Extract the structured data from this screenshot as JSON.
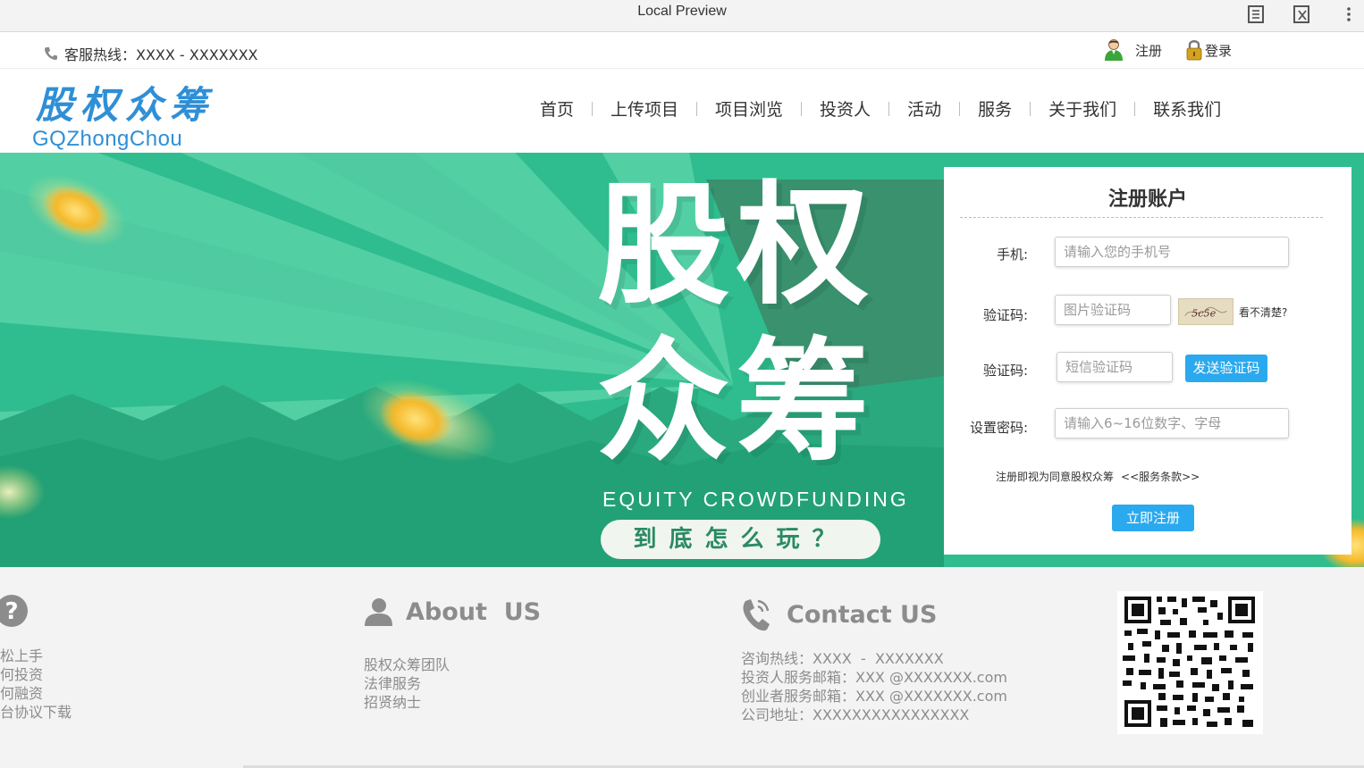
{
  "window": {
    "title": "Local Preview",
    "icons": [
      "reader-view-icon",
      "close-preview-icon",
      "more-options-icon"
    ]
  },
  "topbar": {
    "hotline": "客服热线：XXXX - XXXXXXX",
    "register": "注册",
    "login": "登录"
  },
  "header": {
    "logo_cn": "股权众筹",
    "logo_en": "GQZhongChou",
    "nav": [
      "首页",
      "上传项目",
      "项目浏览",
      "投资人",
      "活动",
      "服务",
      "关于我们",
      "联系我们"
    ]
  },
  "banner": {
    "line1": "股权",
    "line2": "众筹",
    "subtitle": "EQUITY CROWDFUNDING",
    "how_button": "到底怎么玩？",
    "colors": {
      "green": "#2bb789",
      "light_green": "#5dd3a9",
      "dark_green": "#3f8a6b",
      "coin": "#f4b92b"
    }
  },
  "register_panel": {
    "title": "注册账户",
    "phone_label": "手机:",
    "phone_placeholder": "请输入您的手机号",
    "captcha_label": "验证码:",
    "captcha_placeholder": "图片验证码",
    "captcha_text": "5c5e",
    "unclear": "看不清楚?",
    "sms_label": "验证码:",
    "sms_placeholder": "短信验证码",
    "send_button": "发送验证码",
    "password_label": "设置密码:",
    "password_placeholder": "请输入6~16位数字、字母",
    "agree_text": "注册即视为同意股权众筹",
    "terms_link": "<<服务条款>>",
    "submit_button": "立即注册",
    "accent": "#2aa9ee"
  },
  "footer": {
    "help": {
      "links": [
        "轻松上手",
        "如何投资",
        "如何融资",
        "平台协议下载"
      ]
    },
    "about": {
      "title": "About  US",
      "links": [
        "股权众筹团队",
        "法律服务",
        "招贤纳士"
      ]
    },
    "contact": {
      "title": "Contact US",
      "lines": [
        "咨询热线：XXXX  -  XXXXXXX",
        "投资人服务邮箱：XXX @XXXXXXX.com",
        "创业者服务邮箱：XXX @XXXXXXX.com",
        "公司地址：XXXXXXXXXXXXXXXX"
      ]
    },
    "text_color": "#8c8c8c"
  }
}
